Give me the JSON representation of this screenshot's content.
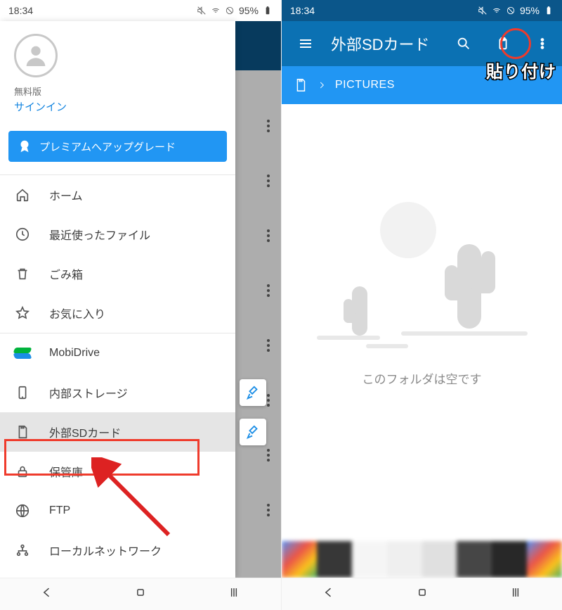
{
  "status": {
    "time": "18:34",
    "battery_text": "95%"
  },
  "left": {
    "plan_label": "無料版",
    "signin_label": "サインイン",
    "upgrade_label": "プレミアムへアップグレード",
    "nav_group1": [
      {
        "label": "ホーム",
        "icon": "home-icon"
      },
      {
        "label": "最近使ったファイル",
        "icon": "clock-icon"
      },
      {
        "label": "ごみ箱",
        "icon": "trash-icon"
      },
      {
        "label": "お気に入り",
        "icon": "star-icon"
      }
    ],
    "nav_group2": [
      {
        "label": "MobiDrive",
        "icon": "mobidrive-icon"
      },
      {
        "label": "内部ストレージ",
        "icon": "phone-icon",
        "clean": true
      },
      {
        "label": "外部SDカード",
        "icon": "sd-card-icon",
        "clean": true,
        "selected": true
      },
      {
        "label": "保管庫",
        "icon": "lock-icon"
      },
      {
        "label": "FTP",
        "icon": "globe-icon"
      },
      {
        "label": "ローカルネットワーク",
        "icon": "network-icon"
      }
    ]
  },
  "right": {
    "title": "外部SDカード",
    "breadcrumb": "PICTURES",
    "empty_text": "このフォルダは空です",
    "paste_annotation": "貼り付け"
  }
}
